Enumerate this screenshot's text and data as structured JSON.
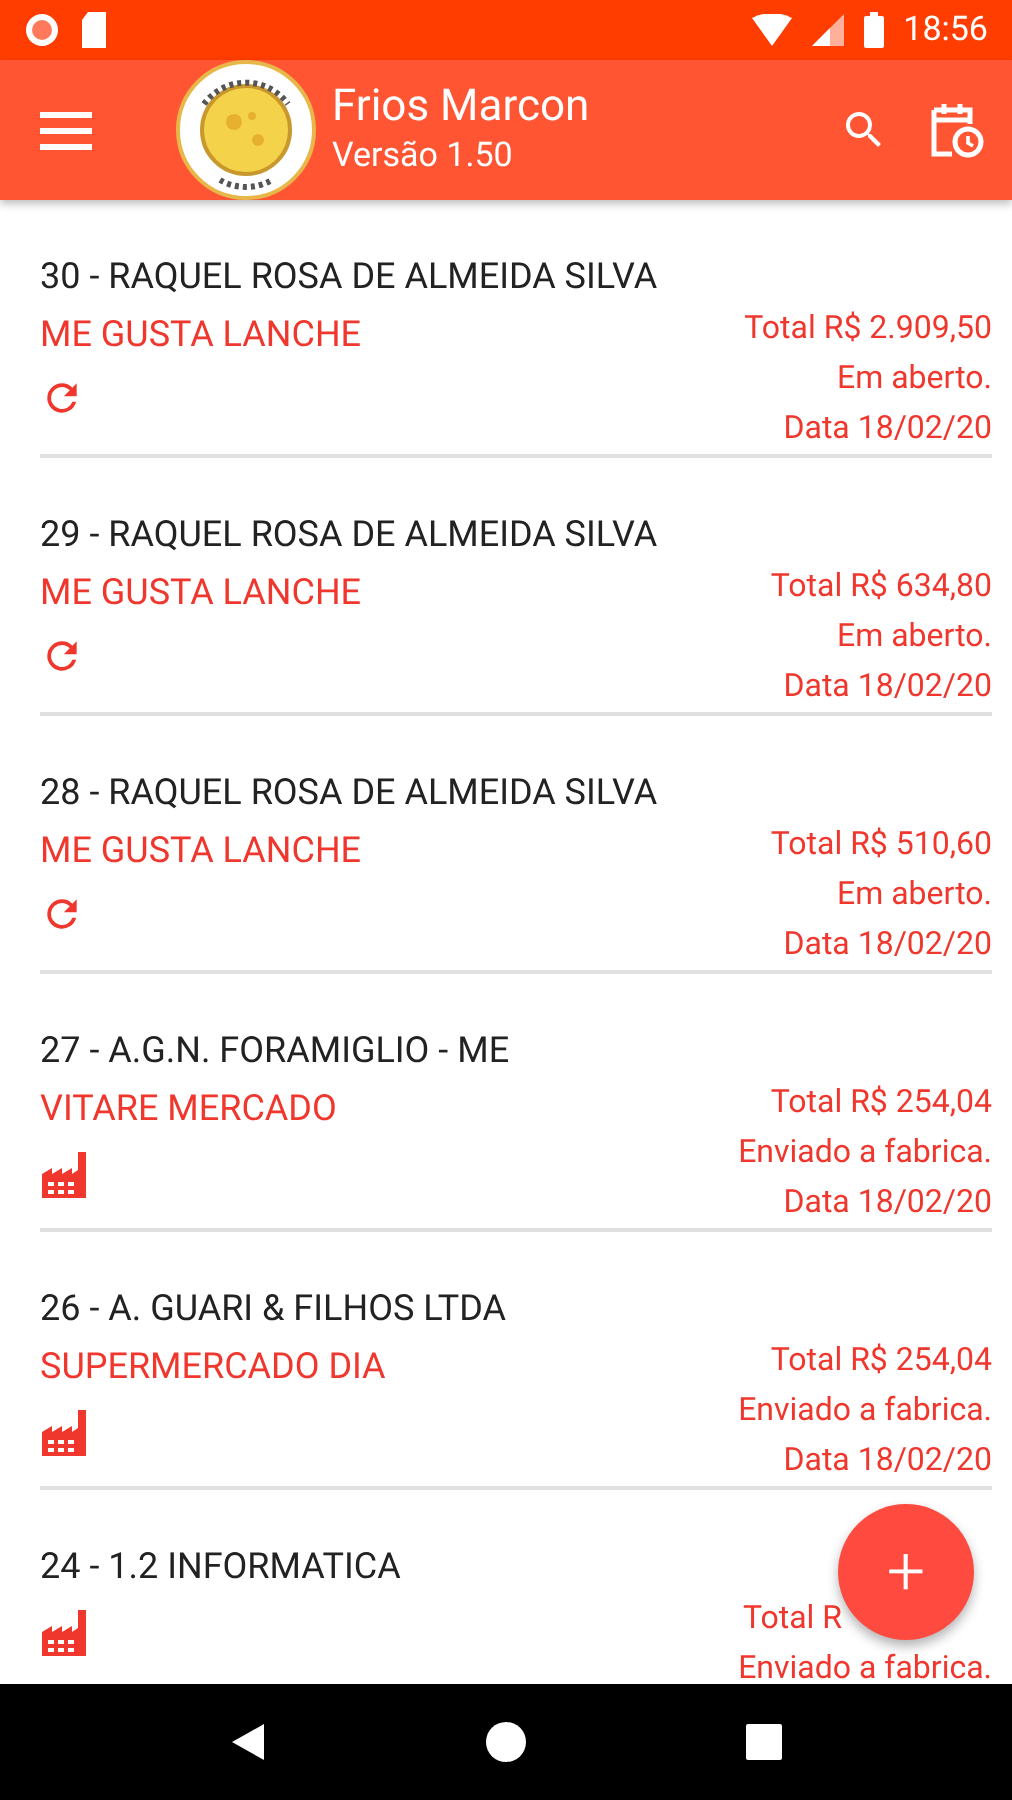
{
  "status_bar": {
    "time": "18:56"
  },
  "app_bar": {
    "title": "Frios Marcon",
    "subtitle": "Versão 1.50"
  },
  "orders": [
    {
      "title": "30 - RAQUEL ROSA DE ALMEIDA SILVA",
      "client": "ME GUSTA LANCHE",
      "total": "Total R$ 2.909,50",
      "status": "Em aberto.",
      "date": "Data 18/02/20",
      "kind": "open"
    },
    {
      "title": "29 - RAQUEL ROSA DE ALMEIDA SILVA",
      "client": "ME GUSTA LANCHE",
      "total": "Total R$ 634,80",
      "status": "Em aberto.",
      "date": "Data 18/02/20",
      "kind": "open"
    },
    {
      "title": "28 - RAQUEL ROSA DE ALMEIDA SILVA",
      "client": "ME GUSTA LANCHE",
      "total": "Total R$ 510,60",
      "status": "Em aberto.",
      "date": "Data 18/02/20",
      "kind": "open"
    },
    {
      "title": "27 - A.G.N. FORAMIGLIO - ME",
      "client": "VITARE MERCADO",
      "total": "Total R$ 254,04",
      "status": "Enviado a fabrica.",
      "date": "Data 18/02/20",
      "kind": "sent"
    },
    {
      "title": "26 - A. GUARI & FILHOS LTDA",
      "client": "SUPERMERCADO DIA",
      "total": "Total R$ 254,04",
      "status": "Enviado a fabrica.",
      "date": "Data 18/02/20",
      "kind": "sent"
    },
    {
      "title": "24 - 1.2 INFORMATICA",
      "total": "Total R",
      "status": "Enviado a fabrica.",
      "kind": "sent"
    }
  ],
  "fab": {
    "label": "+"
  }
}
